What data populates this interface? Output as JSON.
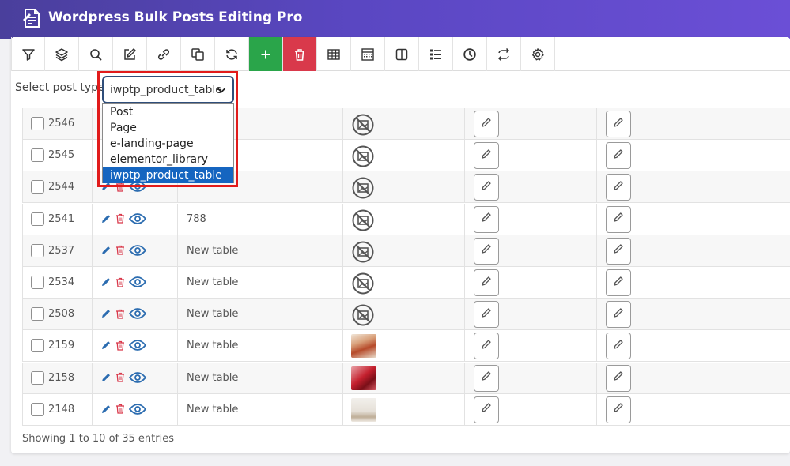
{
  "app": {
    "title": "Wordpress Bulk Posts Editing Pro"
  },
  "toolbar": {
    "buttons": [
      "filter-icon",
      "layers-icon",
      "search-icon",
      "edit-icon",
      "link-icon",
      "duplicate-icon",
      "refresh-icon",
      "plus-icon",
      "trash-icon",
      "table-icon",
      "grid-icon",
      "columns-icon",
      "list-icon",
      "history-icon",
      "swap-icon",
      "gear-icon"
    ]
  },
  "post_type": {
    "label": "Select post type",
    "selected": "iwptp_product_table",
    "options": [
      "Post",
      "Page",
      "e-landing-page",
      "elementor_library",
      "iwptp_product_table"
    ]
  },
  "rows": [
    {
      "id": "2546",
      "title": "",
      "image": "none"
    },
    {
      "id": "2545",
      "title": "",
      "image": "none"
    },
    {
      "id": "2544",
      "title": "",
      "image": "none"
    },
    {
      "id": "2541",
      "title": "788",
      "image": "none"
    },
    {
      "id": "2537",
      "title": "New table",
      "image": "none"
    },
    {
      "id": "2534",
      "title": "New table",
      "image": "none"
    },
    {
      "id": "2508",
      "title": "New table",
      "image": "none"
    },
    {
      "id": "2159",
      "title": "New table",
      "image": "food"
    },
    {
      "id": "2158",
      "title": "New table",
      "image": "meat"
    },
    {
      "id": "2148",
      "title": "New table",
      "image": "person"
    }
  ],
  "footer": {
    "entries": "Showing 1 to 10 of 35 entries"
  },
  "colors": {
    "accent": "#5a47c2",
    "add": "#2aa54a",
    "delete": "#d9394b",
    "selected_option": "#1565c0",
    "highlight": "#e11b1b"
  }
}
